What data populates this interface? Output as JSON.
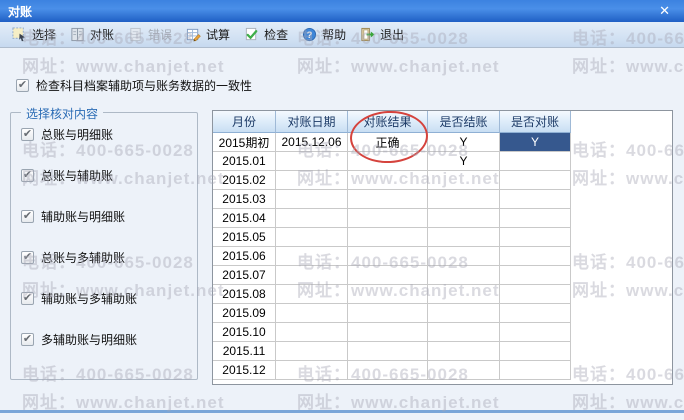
{
  "window": {
    "title": "对账",
    "close_glyph": "✕"
  },
  "toolbar": {
    "buttons": [
      {
        "id": "select",
        "label": "选择",
        "disabled": false
      },
      {
        "id": "reconcile",
        "label": "对账",
        "disabled": false
      },
      {
        "id": "error",
        "label": "错误",
        "disabled": true
      },
      {
        "id": "trial",
        "label": "试算",
        "disabled": false
      },
      {
        "id": "check",
        "label": "检查",
        "disabled": false
      },
      {
        "id": "help",
        "label": "帮助",
        "disabled": false
      },
      {
        "id": "exit",
        "label": "退出",
        "disabled": false
      }
    ]
  },
  "consistency_option": {
    "label": "检查科目档案辅助项与账务数据的一致性",
    "checked": true,
    "check_glyph": "✔"
  },
  "check_group": {
    "title": "选择核对内容",
    "items": [
      {
        "label": "总账与明细账",
        "checked": true
      },
      {
        "label": "总账与辅助账",
        "checked": true
      },
      {
        "label": "辅助账与明细账",
        "checked": true
      },
      {
        "label": "总账与多辅助账",
        "checked": true
      },
      {
        "label": "辅助账与多辅助账",
        "checked": true
      },
      {
        "label": "多辅助账与明细账",
        "checked": true
      }
    ]
  },
  "table": {
    "columns": [
      "月份",
      "对账日期",
      "对账结果",
      "是否结账",
      "是否对账"
    ],
    "rows": [
      [
        "2015期初",
        "2015.12.06",
        "正确",
        "Y",
        "Y"
      ],
      [
        "2015.01",
        "",
        "",
        "Y",
        ""
      ],
      [
        "2015.02",
        "",
        "",
        "",
        ""
      ],
      [
        "2015.03",
        "",
        "",
        "",
        ""
      ],
      [
        "2015.04",
        "",
        "",
        "",
        ""
      ],
      [
        "2015.05",
        "",
        "",
        "",
        ""
      ],
      [
        "2015.06",
        "",
        "",
        "",
        ""
      ],
      [
        "2015.07",
        "",
        "",
        "",
        ""
      ],
      [
        "2015.08",
        "",
        "",
        "",
        ""
      ],
      [
        "2015.09",
        "",
        "",
        "",
        ""
      ],
      [
        "2015.10",
        "",
        "",
        "",
        ""
      ],
      [
        "2015.11",
        "",
        "",
        "",
        ""
      ],
      [
        "2015.12",
        "",
        "",
        "",
        ""
      ]
    ],
    "selected_cell": {
      "row": 0,
      "col": 4
    }
  },
  "annotation": {
    "shape": "ellipse",
    "color": "#d5433d",
    "circled_text": "对账结果 / 正确"
  },
  "watermark": {
    "phone": "电话：400-665-0028",
    "site": "网址：www.chanjet.net"
  },
  "colors": {
    "titlebar_blue": "#2f7be0",
    "selected_cell": "#36588e",
    "annotation_red": "#d5433d"
  }
}
